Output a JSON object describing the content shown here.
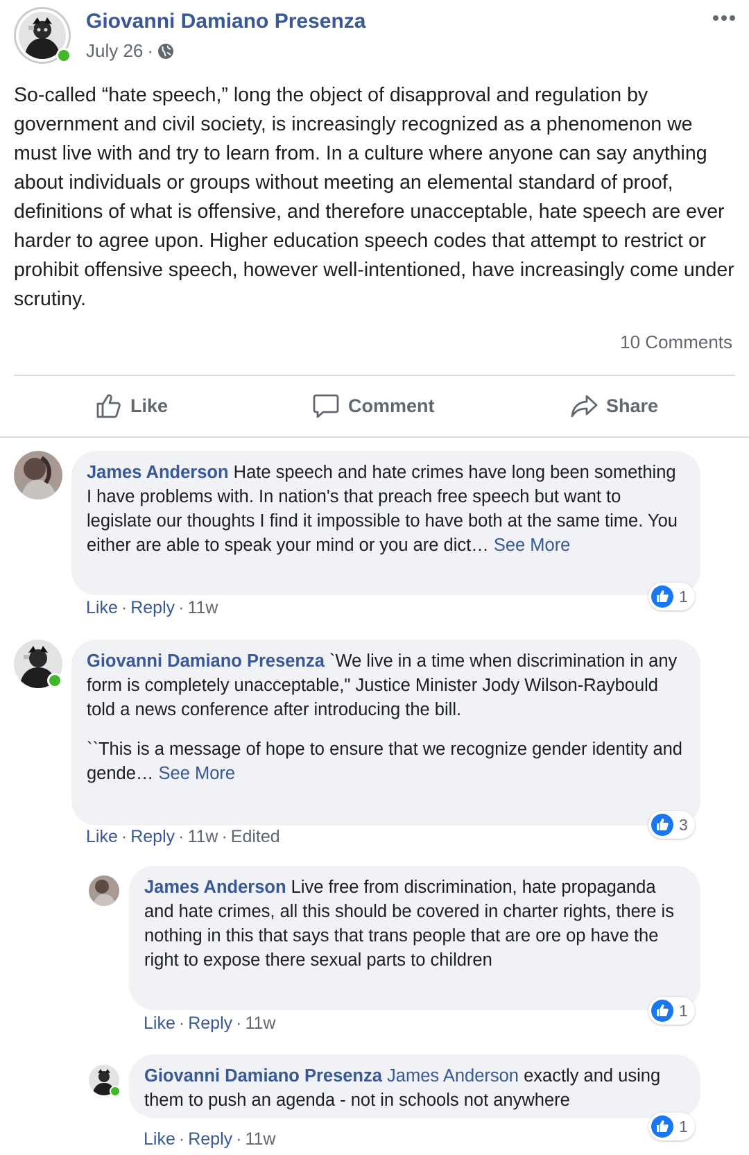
{
  "post": {
    "author": "Giovanni Damiano Presenza",
    "date": "July 26",
    "meta_separator": "·",
    "privacy_icon": "globe-icon",
    "body": "So-called “hate speech,” long the object of disapproval and regulation by government and civil society, is increasingly recognized as a phenomenon we must live with and try to learn from. In a culture where anyone can say anything about individuals or groups without meeting an elemental standard of proof, definitions of what is offensive, and therefore unacceptable, hate speech are ever harder to agree upon. Higher education speech codes that attempt to restrict or prohibit offensive speech, however well-intentioned, have increasingly come under scrutiny.",
    "comments_count": "10 Comments",
    "accent_color": "#385898"
  },
  "actions": {
    "like": "Like",
    "comment": "Comment",
    "share": "Share"
  },
  "comments": [
    {
      "author": "James Anderson",
      "text": "Hate speech and hate crimes have long been something I have problems with. In nation's that preach free speech but want to legislate our thoughts I find it impossible to have both at the same time. You either are able to speak your mind or you are dict…",
      "see_more": "See More",
      "reactions": "1",
      "like": "Like",
      "reply": "Reply",
      "time": "11w"
    },
    {
      "author": "Giovanni Damiano Presenza",
      "text": "`We live in a time when discrimination in any form is completely unacceptable,\" Justice Minister Jody Wilson-Raybould told a news conference after introducing the bill.",
      "text2": "``This is a message of hope to ensure that we recognize gender identity and gende…",
      "see_more": "See More",
      "reactions": "3",
      "like": "Like",
      "reply": "Reply",
      "time": "11w",
      "edited": "Edited"
    },
    {
      "author": "James Anderson",
      "text": "Live free from discrimination, hate propaganda and hate crimes, all this should be covered in charter rights, there is nothing in this that says that trans people that are ore op have the right to expose there sexual parts to children",
      "reactions": "1",
      "like": "Like",
      "reply": "Reply",
      "time": "11w"
    },
    {
      "author": "Giovanni Damiano Presenza",
      "tag": "James Anderson",
      "text": "exactly and using them to push an agenda - not in schools not anywhere",
      "reactions": "1",
      "like": "Like",
      "reply": "Reply",
      "time": "11w"
    }
  ]
}
